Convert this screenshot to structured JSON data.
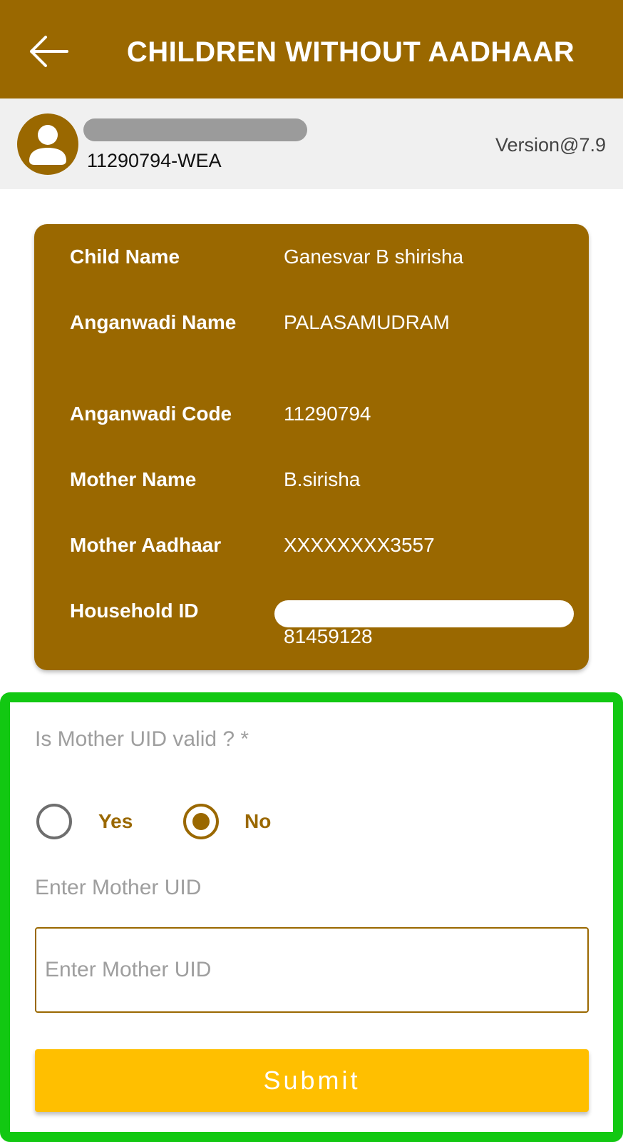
{
  "colors": {
    "primary": "#9a6800",
    "accent": "#ffbf00",
    "highlight_frame": "#12c812",
    "userbar_bg": "#f0f0f0",
    "muted_text": "#9e9e9e"
  },
  "appbar": {
    "back_icon": "arrow-left-icon",
    "title": "CHILDREN WITHOUT AADHAAR"
  },
  "userbar": {
    "avatar_icon": "person-icon",
    "user_code": "11290794-WEA",
    "version": "Version@7.9"
  },
  "child_info": {
    "rows": [
      {
        "label": "Child Name",
        "value": "Ganesvar B shirisha"
      },
      {
        "label": "Anganwadi Name",
        "value": "PALASAMUDRAM"
      },
      {
        "label": "Anganwadi Code",
        "value": "11290794"
      },
      {
        "label": "Mother Name",
        "value": "B.sirisha"
      },
      {
        "label": "Mother Aadhaar",
        "value": "XXXXXXXX3557"
      },
      {
        "label": "Household ID",
        "value": "81459128"
      }
    ]
  },
  "form": {
    "question": "Is Mother UID valid ? *",
    "options": [
      {
        "label": "Yes",
        "selected": false
      },
      {
        "label": "No",
        "selected": true
      }
    ],
    "uid_caption": "Enter Mother UID",
    "uid_value": "",
    "uid_placeholder": "Enter Mother UID",
    "submit_label": "Submit"
  }
}
